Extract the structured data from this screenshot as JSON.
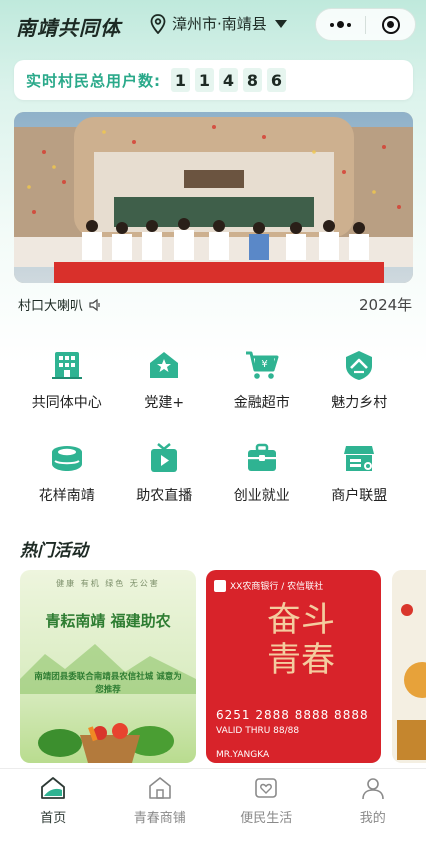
{
  "header": {
    "app_title": "南靖共同体",
    "location": "漳州市·南靖县"
  },
  "counter": {
    "label": "实时村民总用户数:",
    "digits": [
      "1",
      "1",
      "4",
      "8",
      "6"
    ]
  },
  "broadcast": {
    "label": "村口大喇叭",
    "ticker": "2024年"
  },
  "grid": {
    "items": [
      {
        "label": "共同体中心",
        "icon": "building-icon",
        "color": "#2fb392"
      },
      {
        "label": "党建+",
        "icon": "party-house-icon",
        "color": "#2fb392"
      },
      {
        "label": "金融超市",
        "icon": "shopping-cart-icon",
        "color": "#2fb392"
      },
      {
        "label": "魅力乡村",
        "icon": "village-shield-icon",
        "color": "#2fb392"
      },
      {
        "label": "花样南靖",
        "icon": "tulou-icon",
        "color": "#2fb392"
      },
      {
        "label": "助农直播",
        "icon": "live-play-icon",
        "color": "#2fb392"
      },
      {
        "label": "创业就业",
        "icon": "briefcase-icon",
        "color": "#2fb392"
      },
      {
        "label": "商户联盟",
        "icon": "store-icon",
        "color": "#2fb392"
      }
    ]
  },
  "hot": {
    "title": "热门活动",
    "cards": [
      {
        "tags": "健康 有机 绿色 无公害",
        "slogan": "青耘南靖 福建助农",
        "note": "南靖团县委联合南靖县农信社城 诚意为您推荐",
        "button": "诚意为您推荐"
      },
      {
        "bank": "XX农商银行 / 农信联社",
        "calligraphy": "奋斗 青春",
        "card_number": "6251 2888 8888 8888",
        "valid": "VALID THRU 88/88",
        "holder": "MR.YANGKA"
      }
    ]
  },
  "tabbar": {
    "tabs": [
      {
        "label": "首页",
        "icon": "home-icon",
        "active": true
      },
      {
        "label": "青春商铺",
        "icon": "shop-icon",
        "active": false
      },
      {
        "label": "便民生活",
        "icon": "heart-card-icon",
        "active": false
      },
      {
        "label": "我的",
        "icon": "user-icon",
        "active": false
      }
    ]
  },
  "colors": {
    "accent": "#2fb392",
    "counter_label": "#2aa98a",
    "card_red": "#d8232a"
  }
}
